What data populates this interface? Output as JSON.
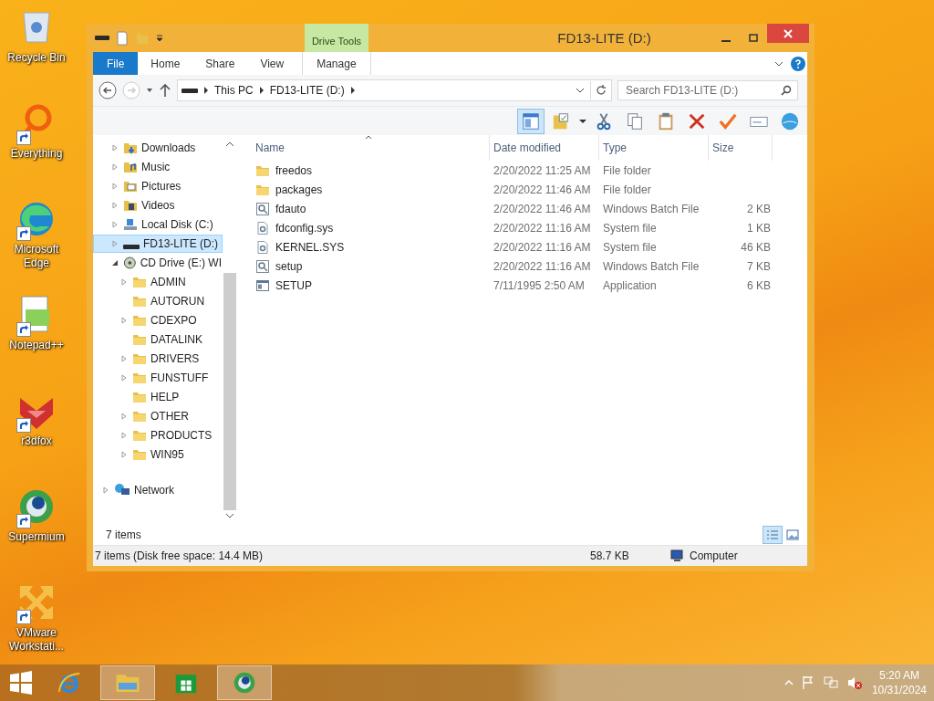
{
  "desktop_icons": [
    {
      "label": "Recycle Bin",
      "kind": "bin",
      "shortcut": false
    },
    {
      "label": "Everything",
      "kind": "search",
      "shortcut": true
    },
    {
      "label": "Microsoft Edge",
      "kind": "edge",
      "shortcut": true
    },
    {
      "label": "Notepad++",
      "kind": "notepad",
      "shortcut": true
    },
    {
      "label": "r3dfox",
      "kind": "fox",
      "shortcut": true
    },
    {
      "label": "Supermium",
      "kind": "globe",
      "shortcut": true
    },
    {
      "label": "VMware Workstati...",
      "kind": "vmware",
      "shortcut": true
    }
  ],
  "window": {
    "title": "FD13-LITE (D:)",
    "contextual_group": "Drive Tools",
    "ribbon_tabs": [
      {
        "label": "File",
        "kind": "file"
      },
      {
        "label": "Home",
        "kind": "tab"
      },
      {
        "label": "Share",
        "kind": "tab"
      },
      {
        "label": "View",
        "kind": "tab"
      },
      {
        "label": "Manage",
        "kind": "contextual"
      }
    ],
    "breadcrumb": [
      "This PC",
      "FD13-LITE (D:)"
    ],
    "search": {
      "placeholder": "Search FD13-LITE (D:)"
    },
    "toolbar": [
      {
        "kind": "preview",
        "selected": true
      },
      {
        "kind": "properties",
        "selected": false
      },
      {
        "kind": "cut",
        "selected": false
      },
      {
        "kind": "copy",
        "selected": false
      },
      {
        "kind": "paste",
        "selected": false
      },
      {
        "kind": "delete",
        "selected": false
      },
      {
        "kind": "check",
        "selected": false
      },
      {
        "kind": "rename",
        "selected": false
      },
      {
        "kind": "globe",
        "selected": false
      }
    ],
    "nav_tree": [
      {
        "label": "Downloads",
        "kind": "downloads",
        "expanded": false,
        "selected": false
      },
      {
        "label": "Music",
        "kind": "music",
        "expanded": false,
        "selected": false
      },
      {
        "label": "Pictures",
        "kind": "pictures",
        "expanded": false,
        "selected": false
      },
      {
        "label": "Videos",
        "kind": "videos",
        "expanded": false,
        "selected": false
      },
      {
        "label": "Local Disk (C:)",
        "kind": "disk",
        "expanded": false,
        "selected": false
      },
      {
        "label": "FD13-LITE (D:)",
        "kind": "drive",
        "expanded": false,
        "selected": true
      },
      {
        "label": "CD Drive (E:) WI",
        "kind": "cd",
        "expanded": true,
        "selected": false,
        "children": [
          {
            "label": "ADMIN",
            "kind": "folder",
            "expandable": true,
            "selected": false
          },
          {
            "label": "AUTORUN",
            "kind": "folder",
            "expandable": false,
            "selected": false
          },
          {
            "label": "CDEXPO",
            "kind": "folder",
            "expandable": true,
            "selected": false
          },
          {
            "label": "DATALINK",
            "kind": "folder",
            "expandable": false,
            "selected": false
          },
          {
            "label": "DRIVERS",
            "kind": "folder",
            "expandable": true,
            "selected": false
          },
          {
            "label": "FUNSTUFF",
            "kind": "folder",
            "expandable": true,
            "selected": false
          },
          {
            "label": "HELP",
            "kind": "folder",
            "expandable": false,
            "selected": false
          },
          {
            "label": "OTHER",
            "kind": "folder",
            "expandable": true,
            "selected": false
          },
          {
            "label": "PRODUCTS",
            "kind": "folder",
            "expandable": true,
            "selected": false
          },
          {
            "label": "WIN95",
            "kind": "folder",
            "expandable": true,
            "selected": false
          }
        ]
      }
    ],
    "network": {
      "label": "Network",
      "expanded": false
    },
    "table": {
      "columns": [
        "Name",
        "Date modified",
        "Type",
        "Size"
      ],
      "rows": [
        {
          "name": "freedos",
          "date": "2/20/2022 11:25 AM",
          "type": "File folder",
          "size": "",
          "kind": "folder"
        },
        {
          "name": "packages",
          "date": "2/20/2022 11:46 AM",
          "type": "File folder",
          "size": "",
          "kind": "folder"
        },
        {
          "name": "fdauto",
          "date": "2/20/2022 11:46 AM",
          "type": "Windows Batch File",
          "size": "2 KB",
          "kind": "batch"
        },
        {
          "name": "fdconfig.sys",
          "date": "2/20/2022 11:16 AM",
          "type": "System file",
          "size": "1 KB",
          "kind": "sys"
        },
        {
          "name": "KERNEL.SYS",
          "date": "2/20/2022 11:16 AM",
          "type": "System file",
          "size": "46 KB",
          "kind": "sys"
        },
        {
          "name": "setup",
          "date": "2/20/2022 11:16 AM",
          "type": "Windows Batch File",
          "size": "7 KB",
          "kind": "batch"
        },
        {
          "name": "SETUP",
          "date": "7/11/1995 2:50 AM",
          "type": "Application",
          "size": "6 KB",
          "kind": "app"
        }
      ]
    },
    "item_count": "7 items",
    "views": [
      {
        "kind": "details",
        "selected": true
      },
      {
        "kind": "large",
        "selected": false
      }
    ],
    "status_bar": {
      "summary": "7 items (Disk free space: 14.4 MB)",
      "size": "58.7 KB",
      "location": "Computer"
    }
  },
  "taskbar": {
    "apps": [
      {
        "kind": "ie",
        "running": false
      },
      {
        "kind": "explorer",
        "running": true
      },
      {
        "kind": "store",
        "running": false
      },
      {
        "kind": "globe",
        "running": true
      }
    ],
    "time": "5:20 AM",
    "date": "10/31/2024"
  }
}
